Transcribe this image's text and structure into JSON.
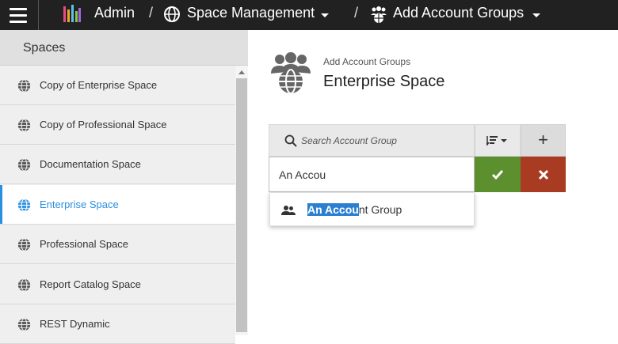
{
  "topbar": {
    "app_label": "Admin",
    "breadcrumb_sep": "/",
    "space_mgmt_label": "Space Management",
    "add_groups_label": "Add Account Groups"
  },
  "sidebar": {
    "header": "Spaces",
    "items": [
      {
        "label": "Copy of Enterprise Space",
        "active": false
      },
      {
        "label": "Copy of Professional Space",
        "active": false
      },
      {
        "label": "Documentation Space",
        "active": false
      },
      {
        "label": "Enterprise Space",
        "active": true
      },
      {
        "label": "Professional Space",
        "active": false
      },
      {
        "label": "Report Catalog Space",
        "active": false
      },
      {
        "label": "REST Dynamic",
        "active": false
      }
    ]
  },
  "main": {
    "subtitle": "Add Account Groups",
    "title": "Enterprise Space",
    "search": {
      "placeholder": "Search Account Group",
      "value": ""
    },
    "name_input": {
      "value": "An Accou"
    },
    "add_label": "+",
    "suggestion": {
      "match": "An Accou",
      "rest": "nt Group"
    }
  },
  "colors": {
    "topbar": "#212121",
    "accent": "#2b8fdf",
    "confirm": "#5c8f2e",
    "cancel": "#a83b22"
  },
  "icons": {
    "menu": "hamburger-icon",
    "logo": "logo-icon",
    "globe": "globe-icon",
    "groups": "people-icon",
    "search": "search-icon",
    "sort": "sort-icon",
    "confirm": "check-icon",
    "cancel": "close-icon"
  }
}
